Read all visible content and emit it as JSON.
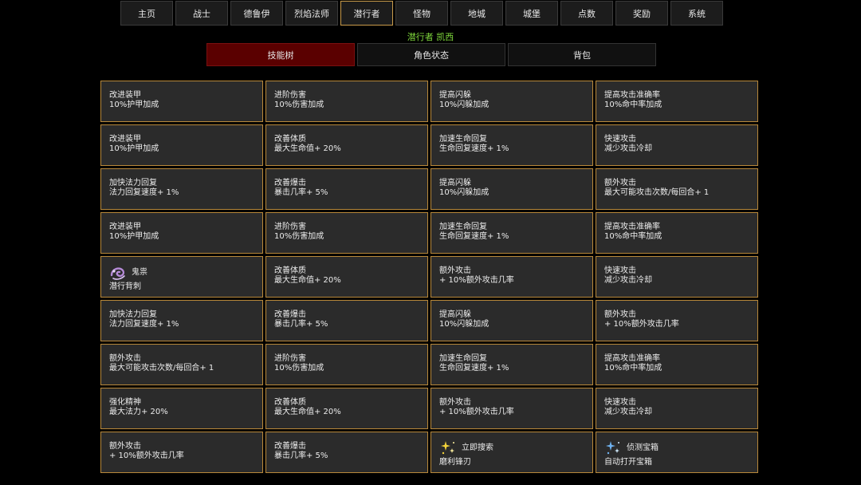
{
  "nav": {
    "active_index": 4,
    "items": [
      "主页",
      "战士",
      "德鲁伊",
      "烈焰法师",
      "潜行者",
      "怪物",
      "地城",
      "城堡",
      "点数",
      "奖励",
      "系统"
    ]
  },
  "subtitle": "潜行者 凯西",
  "tabs": {
    "active_index": 0,
    "items": [
      "技能树",
      "角色状态",
      "背包"
    ]
  },
  "colors": {
    "accent_border": "#b8883a",
    "active_tab_bg": "#5a0000",
    "subtitle": "#7fd83c"
  },
  "skills": [
    [
      {
        "name": "改进装甲",
        "desc": "10%护甲加成"
      },
      {
        "name": "进阶伤害",
        "desc": "10%伤害加成"
      },
      {
        "name": "提高闪躲",
        "desc": "10%闪躲加成"
      },
      {
        "name": "提高攻击准确率",
        "desc": "10%命中率加成"
      }
    ],
    [
      {
        "name": "改进装甲",
        "desc": "10%护甲加成"
      },
      {
        "name": "改善体质",
        "desc": "最大生命值+ 20%"
      },
      {
        "name": "加速生命回复",
        "desc": "生命回复速度+ 1%"
      },
      {
        "name": "快速攻击",
        "desc": "减少攻击冷却"
      }
    ],
    [
      {
        "name": "加快法力回复",
        "desc": "法力回复速度+ 1%"
      },
      {
        "name": "改善爆击",
        "desc": "暴击几率+ 5%"
      },
      {
        "name": "提高闪躲",
        "desc": "10%闪躲加成"
      },
      {
        "name": "额外攻击",
        "desc": "最大可能攻击次数/每回合+ 1"
      }
    ],
    [
      {
        "name": "改进装甲",
        "desc": "10%护甲加成"
      },
      {
        "name": "进阶伤害",
        "desc": "10%伤害加成"
      },
      {
        "name": "加速生命回复",
        "desc": "生命回复速度+ 1%"
      },
      {
        "name": "提高攻击准确率",
        "desc": "10%命中率加成"
      }
    ],
    [
      {
        "name": "鬼祟",
        "desc": "潜行背刺",
        "special": true,
        "icon": "purple-swirl-icon"
      },
      {
        "name": "改善体质",
        "desc": "最大生命值+ 20%"
      },
      {
        "name": "额外攻击",
        "desc": "+ 10%额外攻击几率"
      },
      {
        "name": "快速攻击",
        "desc": "减少攻击冷却"
      }
    ],
    [
      {
        "name": "加快法力回复",
        "desc": "法力回复速度+ 1%"
      },
      {
        "name": "改善爆击",
        "desc": "暴击几率+ 5%"
      },
      {
        "name": "提高闪躲",
        "desc": "10%闪躲加成"
      },
      {
        "name": "额外攻击",
        "desc": "+ 10%额外攻击几率"
      }
    ],
    [
      {
        "name": "额外攻击",
        "desc": "最大可能攻击次数/每回合+ 1"
      },
      {
        "name": "进阶伤害",
        "desc": "10%伤害加成"
      },
      {
        "name": "加速生命回复",
        "desc": "生命回复速度+ 1%"
      },
      {
        "name": "提高攻击准确率",
        "desc": "10%命中率加成"
      }
    ],
    [
      {
        "name": "强化精神",
        "desc": "最大法力+ 20%"
      },
      {
        "name": "改善体质",
        "desc": "最大生命值+ 20%"
      },
      {
        "name": "额外攻击",
        "desc": "+ 10%额外攻击几率"
      },
      {
        "name": "快速攻击",
        "desc": "减少攻击冷却"
      }
    ],
    [
      {
        "name": "额外攻击",
        "desc": "+ 10%额外攻击几率"
      },
      {
        "name": "改善爆击",
        "desc": "暴击几率+ 5%"
      },
      {
        "name": "立即搜索",
        "desc": "磨利锋刃",
        "special": true,
        "icon": "gold-sparkle-icon"
      },
      {
        "name": "侦测宝箱",
        "desc": "自动打开宝箱",
        "special": true,
        "icon": "blue-sparkle-icon"
      }
    ]
  ]
}
